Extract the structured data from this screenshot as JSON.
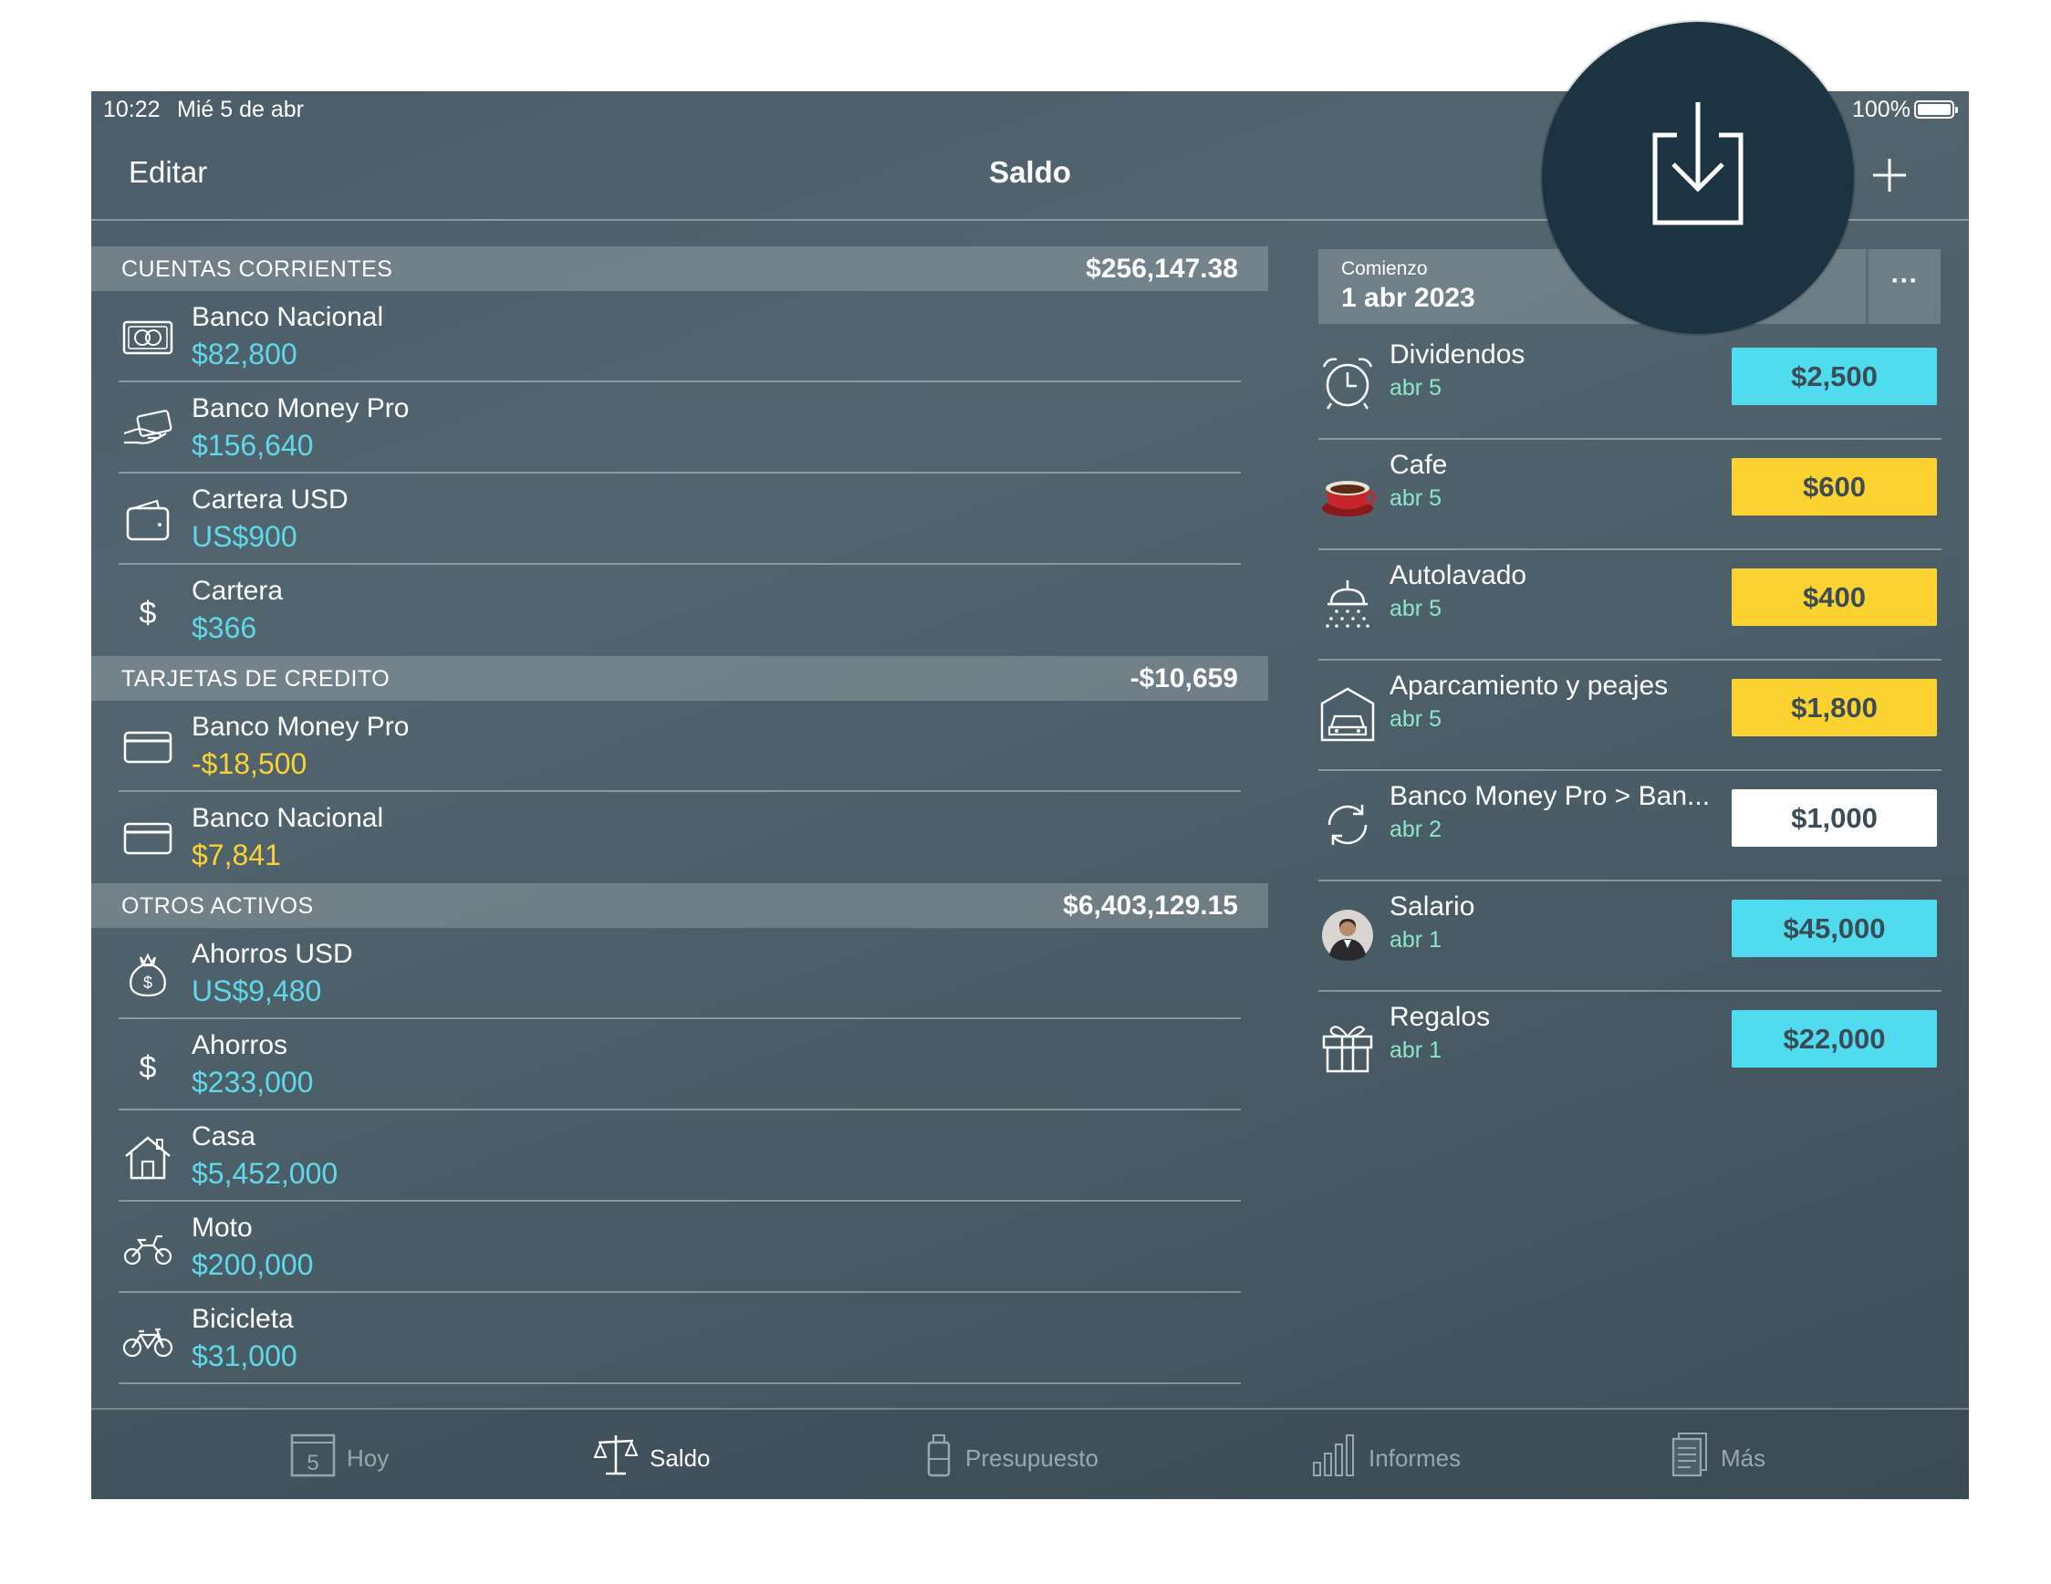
{
  "status": {
    "time": "10:22",
    "date": "Mié 5 de abr",
    "battery": "100%"
  },
  "nav": {
    "edit": "Editar",
    "title": "Saldo"
  },
  "sections": [
    {
      "title": "CUENTAS CORRIENTES",
      "total": "$256,147.38",
      "accounts": [
        {
          "name": "Banco Nacional",
          "balance": "$82,800",
          "icon": "cash-icon"
        },
        {
          "name": "Banco Money Pro",
          "balance": "$156,640",
          "icon": "hand-card-icon"
        },
        {
          "name": "Cartera USD",
          "balance": "US$900",
          "icon": "wallet-icon"
        },
        {
          "name": "Cartera",
          "balance": "$366",
          "icon": "dollar-icon"
        }
      ]
    },
    {
      "title": "TARJETAS DE CREDITO",
      "total": "-$10,659",
      "accounts": [
        {
          "name": "Banco Money Pro",
          "balance": "-$18,500",
          "icon": "credit-card-icon"
        },
        {
          "name": "Banco Nacional",
          "balance": "$7,841",
          "icon": "credit-card-icon"
        }
      ]
    },
    {
      "title": "OTROS ACTIVOS",
      "total": "$6,403,129.15",
      "accounts": [
        {
          "name": "Ahorros USD",
          "balance": "US$9,480",
          "icon": "money-bag-icon"
        },
        {
          "name": "Ahorros",
          "balance": "$233,000",
          "icon": "dollar-icon"
        },
        {
          "name": "Casa",
          "balance": "$5,452,000",
          "icon": "house-icon"
        },
        {
          "name": "Moto",
          "balance": "$200,000",
          "icon": "motorcycle-icon"
        },
        {
          "name": "Bicicleta",
          "balance": "$31,000",
          "icon": "bicycle-icon"
        }
      ]
    }
  ],
  "period": {
    "label": "Comienzo",
    "date": "1 abr 2023",
    "more": "···"
  },
  "transactions": [
    {
      "name": "Dividendos",
      "date": "abr 5",
      "amount": "$2,500",
      "type": "income",
      "icon": "alarm-clock-icon"
    },
    {
      "name": "Cafe",
      "date": "abr 5",
      "amount": "$600",
      "type": "expense",
      "icon": "coffee-cup-icon"
    },
    {
      "name": "Autolavado",
      "date": "abr 5",
      "amount": "$400",
      "type": "expense",
      "icon": "car-wash-icon"
    },
    {
      "name": "Aparcamiento y peajes",
      "date": "abr 5",
      "amount": "$1,800",
      "type": "expense",
      "icon": "garage-icon"
    },
    {
      "name": "Banco Money Pro > Ban...",
      "date": "abr 2",
      "amount": "$1,000",
      "type": "transfer",
      "icon": "transfer-icon"
    },
    {
      "name": "Salario",
      "date": "abr 1",
      "amount": "$45,000",
      "type": "income",
      "icon": "person-avatar-icon"
    },
    {
      "name": "Regalos",
      "date": "abr 1",
      "amount": "$22,000",
      "type": "income",
      "icon": "gift-icon"
    }
  ],
  "tabs": [
    {
      "label": "Hoy",
      "icon": "calendar-icon",
      "badge": "5",
      "active": false
    },
    {
      "label": "Saldo",
      "icon": "scales-icon",
      "active": true
    },
    {
      "label": "Presupuesto",
      "icon": "budget-icon",
      "active": false
    },
    {
      "label": "Informes",
      "icon": "bar-chart-icon",
      "active": false
    },
    {
      "label": "Más",
      "icon": "document-icon",
      "active": false
    }
  ],
  "colors": {
    "income": "#51dbee",
    "expense": "#fbd22f",
    "transfer": "#ffffff",
    "balance_positive": "#5fd9ea",
    "balance_credit": "#f9d235"
  },
  "highlight": {
    "icon": "download-icon"
  }
}
